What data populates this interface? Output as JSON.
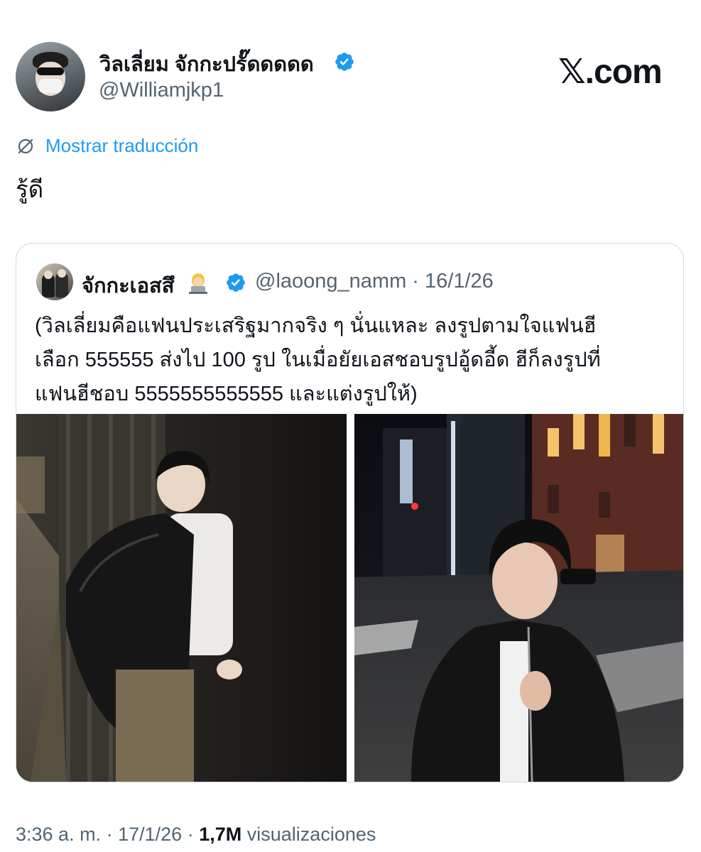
{
  "author": {
    "display_name": "วิลเลี่ยม จักกะปรั๊ดดดดด",
    "handle": "@Williamjkp1",
    "verified": true
  },
  "brand": {
    "logo_text": "𝕏.com"
  },
  "translate": {
    "label": "Mostrar traducción"
  },
  "tweet": {
    "text": "รู้ดี"
  },
  "quoted_tweet": {
    "display_name": "จักกะเอสสึ",
    "emoji": "technologist",
    "verified": true,
    "handle": "@laoong_namm",
    "separator": "·",
    "date": "16/1/26",
    "text_lines": [
      "(วิลเลี่ยมคือแฟนประเสริฐมากจริง ๆ นั่นแหละ ลงรูปตามใจแฟนฮี",
      "เลือก 555555 ส่งไป 100 รูป ในเมื่อยัยเอสชอบรูปอู้ดอี้ด ฮีก็ลงรูปที่",
      "แฟนฮีชอบ 5555555555555 และแต่งรูปให้)"
    ],
    "images": [
      "night-street-photo-leaning-on-wall",
      "night-city-crosswalk-photo"
    ]
  },
  "meta": {
    "time": "3:36 a. m.",
    "separator": "·",
    "date": "17/1/26",
    "views_count": "1,7M",
    "views_label": "visualizaciones"
  },
  "colors": {
    "accent": "#1d9bf0",
    "secondary_text": "#536471",
    "border": "#cfd9de",
    "text": "#0f1419"
  }
}
